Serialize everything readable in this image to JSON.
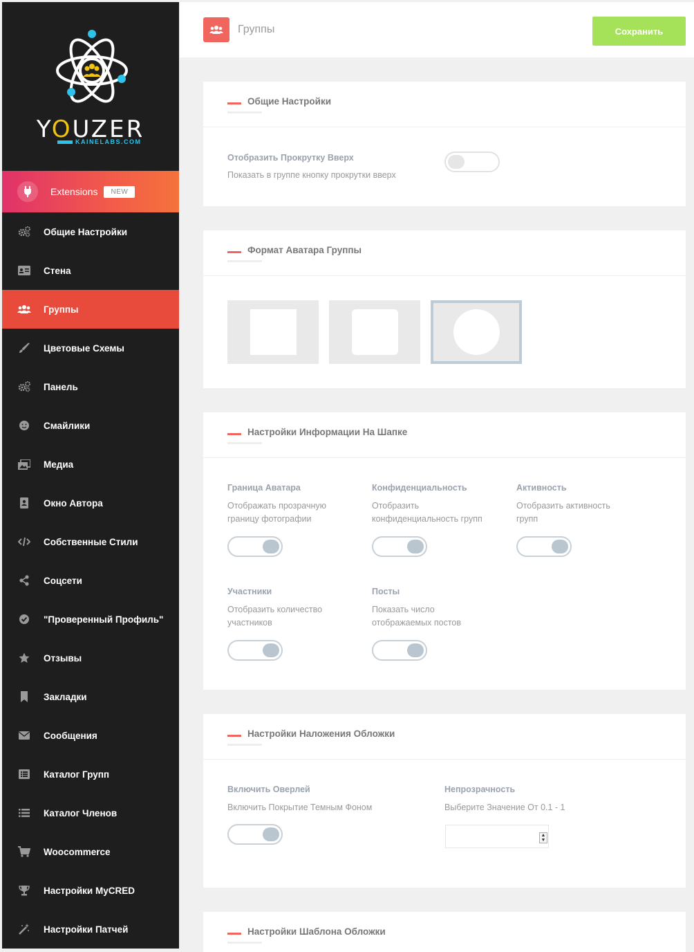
{
  "sidebar": {
    "brand": "YOUZER",
    "brand_prefix": "Y",
    "brand_o": "O",
    "brand_suffix": "UZER",
    "sub": "KAINELABS.COM",
    "extensions": {
      "label": "Extensions",
      "badge": "NEW"
    },
    "items": [
      {
        "label": "Общие Настройки",
        "icon": "gears-icon",
        "active": false
      },
      {
        "label": "Стена",
        "icon": "id-card-icon",
        "active": false
      },
      {
        "label": "Группы",
        "icon": "users-icon",
        "active": true
      },
      {
        "label": "Цветовые Схемы",
        "icon": "brush-icon",
        "active": false
      },
      {
        "label": "Панель",
        "icon": "gears-icon",
        "active": false
      },
      {
        "label": "Смайлики",
        "icon": "smile-icon",
        "active": false
      },
      {
        "label": "Медиа",
        "icon": "images-icon",
        "active": false
      },
      {
        "label": "Окно Автора",
        "icon": "author-box-icon",
        "active": false
      },
      {
        "label": "Собственные Стили",
        "icon": "code-icon",
        "active": false
      },
      {
        "label": "Соцсети",
        "icon": "share-icon",
        "active": false
      },
      {
        "label": "\"Проверенный Профиль\"",
        "icon": "check-circle-icon",
        "active": false
      },
      {
        "label": "Отзывы",
        "icon": "star-icon",
        "active": false
      },
      {
        "label": "Закладки",
        "icon": "bookmark-icon",
        "active": false
      },
      {
        "label": "Сообщения",
        "icon": "envelope-icon",
        "active": false
      },
      {
        "label": "Каталог Групп",
        "icon": "list-alt-icon",
        "active": false
      },
      {
        "label": "Каталог Членов",
        "icon": "list-icon",
        "active": false
      },
      {
        "label": "Woocommerce",
        "icon": "cart-icon",
        "active": false
      },
      {
        "label": "Настройки MyCRED",
        "icon": "trophy-icon",
        "active": false
      },
      {
        "label": "Настройки Патчей",
        "icon": "magic-icon",
        "active": false
      }
    ]
  },
  "header": {
    "title": "Группы",
    "save_label": "Сохранить",
    "icon": "users-icon"
  },
  "cards": {
    "general": {
      "title": "Общие Настройки",
      "scroll": {
        "label": "Отобразить Прокрутку Вверх",
        "desc": "Показать в группе кнопку прокрутки вверх",
        "enabled": false
      }
    },
    "avatar_format": {
      "title": "Формат Аватара Группы",
      "options": [
        "square",
        "rounded",
        "circle"
      ],
      "selected": "circle"
    },
    "header_info": {
      "title": "Настройки Информации На Шапке",
      "options": [
        {
          "label": "Граница Аватара",
          "desc1": "Отображать прозрачную",
          "desc2": "границу фотографии",
          "enabled": true
        },
        {
          "label": "Конфиденциальность",
          "desc1": "Отобразить",
          "desc2": "конфиденциальность групп",
          "enabled": true
        },
        {
          "label": "Активность",
          "desc1": "Отобразить активность",
          "desc2": "групп",
          "enabled": true
        },
        {
          "label": "Участники",
          "desc1": "Отобразить количество",
          "desc2": "участников",
          "enabled": true
        },
        {
          "label": "Посты",
          "desc1": "Показать число",
          "desc2": "отображаемых постов",
          "enabled": true
        }
      ]
    },
    "overlay": {
      "title": "Настройки Наложения Обложки",
      "enable": {
        "label": "Включить Оверлей",
        "desc": "Включить Покрытие Темным Фоном",
        "enabled": true
      },
      "opacity": {
        "label": "Непрозрачность",
        "desc": "Выберите Значение От 0.1 - 1",
        "value": ""
      }
    },
    "pattern": {
      "title": "Настройки Шаблона Обложки"
    }
  },
  "colors": {
    "sidebar_bg": "#1e1e1e",
    "accent": "#e84b3c",
    "save": "#a6e15a",
    "page_bg": "#f0f0f0"
  }
}
